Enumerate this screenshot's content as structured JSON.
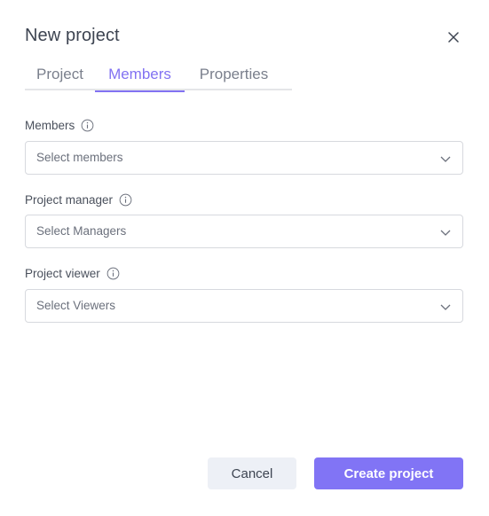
{
  "dialog": {
    "title": "New project",
    "close_icon": "close-icon"
  },
  "tabs": [
    {
      "label": "Project",
      "active": false
    },
    {
      "label": "Members",
      "active": true
    },
    {
      "label": "Properties",
      "active": false
    }
  ],
  "fields": [
    {
      "label": "Members",
      "info_icon": "info-icon",
      "placeholder": "Select members",
      "value": ""
    },
    {
      "label": "Project manager",
      "info_icon": "info-icon",
      "placeholder": "Select Managers",
      "value": ""
    },
    {
      "label": "Project viewer",
      "info_icon": "info-icon",
      "placeholder": "Select Viewers",
      "value": ""
    }
  ],
  "footer": {
    "cancel_label": "Cancel",
    "create_label": "Create project"
  },
  "colors": {
    "accent": "#8174f5",
    "cancel_bg": "#edf0f6",
    "text": "#3d4451"
  }
}
